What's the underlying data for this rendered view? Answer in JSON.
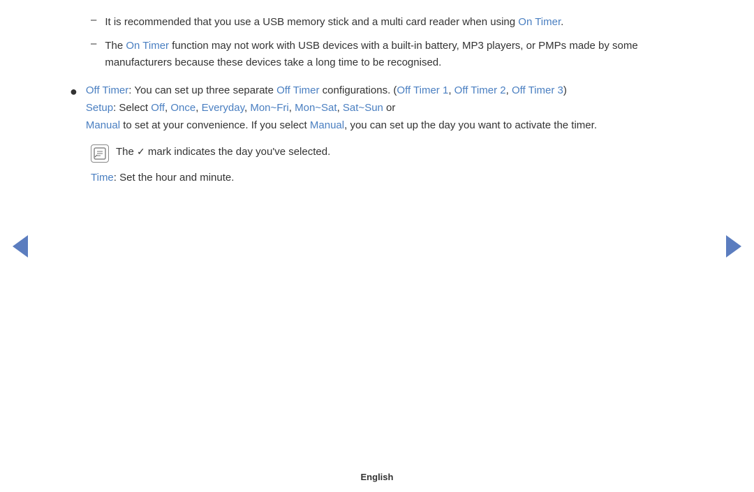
{
  "content": {
    "dash_items": [
      {
        "id": "dash1",
        "text_parts": [
          {
            "text": "It is recommended that you use a USB memory stick and a multi card reader when using ",
            "blue": false
          },
          {
            "text": "On Timer",
            "blue": true
          },
          {
            "text": ".",
            "blue": false
          }
        ]
      },
      {
        "id": "dash2",
        "text_parts": [
          {
            "text": "The ",
            "blue": false
          },
          {
            "text": "On Timer",
            "blue": true
          },
          {
            "text": " function may not work with USB devices with a built-in battery, MP3 players, or PMPs made by some manufacturers because these devices take a long time to be recognised.",
            "blue": false
          }
        ]
      }
    ],
    "bullet_item": {
      "line1_parts": [
        {
          "text": "Off Timer",
          "blue": true
        },
        {
          "text": ": You can set up three separate ",
          "blue": false
        },
        {
          "text": "Off Timer",
          "blue": true
        },
        {
          "text": " configurations. (",
          "blue": false
        },
        {
          "text": "Off Timer 1",
          "blue": true
        },
        {
          "text": ", ",
          "blue": false
        },
        {
          "text": "Off Timer 2",
          "blue": true
        },
        {
          "text": ", ",
          "blue": false
        },
        {
          "text": "Off Timer 3",
          "blue": true
        },
        {
          "text": ")",
          "blue": false
        }
      ],
      "line2_parts": [
        {
          "text": "Setup",
          "blue": true
        },
        {
          "text": ": Select ",
          "blue": false
        },
        {
          "text": "Off",
          "blue": true
        },
        {
          "text": ", ",
          "blue": false
        },
        {
          "text": "Once",
          "blue": true
        },
        {
          "text": ", ",
          "blue": false
        },
        {
          "text": "Everyday",
          "blue": true
        },
        {
          "text": ", ",
          "blue": false
        },
        {
          "text": "Mon~Fri",
          "blue": true
        },
        {
          "text": ", ",
          "blue": false
        },
        {
          "text": "Mon~Sat",
          "blue": true
        },
        {
          "text": ", ",
          "blue": false
        },
        {
          "text": "Sat~Sun",
          "blue": true
        },
        {
          "text": " or",
          "blue": false
        }
      ],
      "line3_parts": [
        {
          "text": "Manual",
          "blue": true
        },
        {
          "text": " to set at your convenience. If you select ",
          "blue": false
        },
        {
          "text": "Manual",
          "blue": true
        },
        {
          "text": ", you can set up the day you want to activate the timer.",
          "blue": false
        }
      ]
    },
    "note": {
      "icon_char": "M",
      "text_parts": [
        {
          "text": "The ",
          "blue": false
        },
        {
          "text": "✓",
          "blue": false,
          "special": true
        },
        {
          "text": " mark indicates the day you’ve selected.",
          "blue": false
        }
      ]
    },
    "time_line": {
      "parts": [
        {
          "text": "Time",
          "blue": true
        },
        {
          "text": ": Set the hour and minute.",
          "blue": false
        }
      ]
    }
  },
  "nav": {
    "left_label": "previous",
    "right_label": "next"
  },
  "footer": {
    "language": "English"
  }
}
